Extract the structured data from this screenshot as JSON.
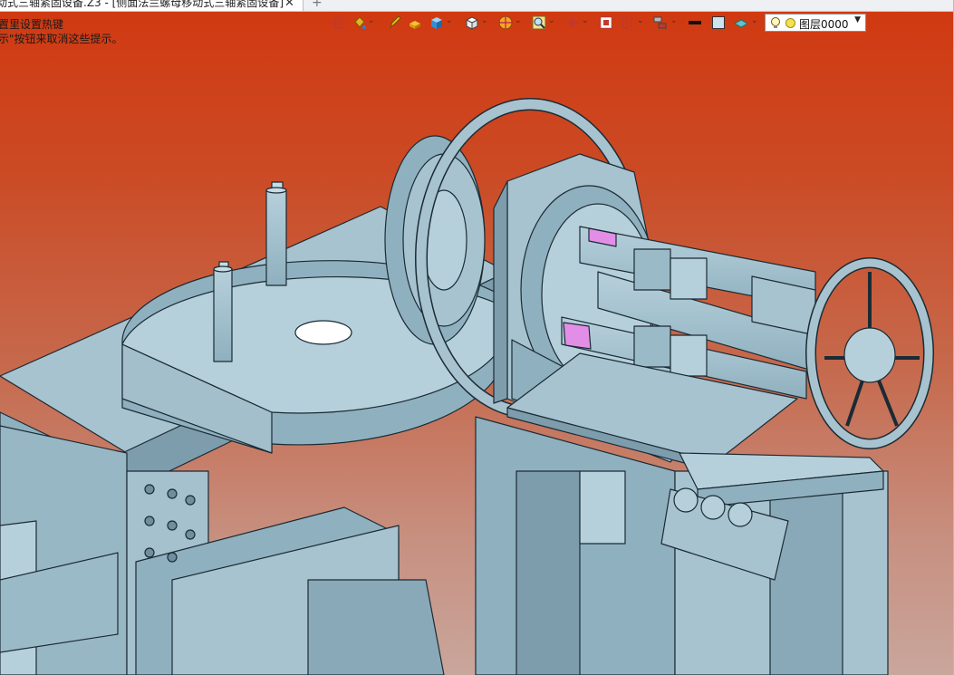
{
  "document": {
    "tab_title": "动式三轴紧固设备.Z3 - [侧面法兰螺母移动式三轴紧固设备]",
    "tab_close": "✕",
    "tab_add": "+"
  },
  "hints": {
    "line1": "置里设置热键",
    "line2": "示\"按钮来取消这些提示。"
  },
  "toolbar": {
    "icons": [
      "exit-icon",
      "paint-bucket-icon",
      "pencil-icon",
      "block-color-icon",
      "cube-shaded-icon",
      "cube-wire-icon",
      "color-wheel-icon",
      "zoom-fit-icon",
      "pivot-icon",
      "screen-capture-icon",
      "section-view-icon",
      "layers-filter-icon",
      "line-color-icon",
      "fill-color-icon",
      "surface-icon"
    ],
    "layer_value": "图层0000",
    "dropdown_glyph": "⌄"
  },
  "colors": {
    "background_top": "#d13810",
    "background_bottom": "#c9a69c",
    "model_face": "#a7c3cf",
    "model_edge": "#1b2b34",
    "highlight": "#e28ee6"
  }
}
